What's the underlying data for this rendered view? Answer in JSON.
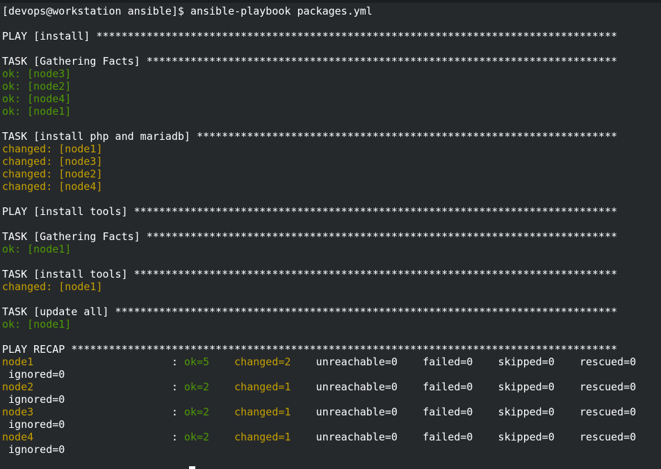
{
  "terminal": {
    "colors": {
      "background": "#26292c",
      "default_text": "#ffffff",
      "ok": "#4e9a06",
      "changed": "#c4a000"
    },
    "lines": [
      [
        {
          "t": "[devops@workstation ansible]$ ansible-playbook packages.yml",
          "c": "default_text"
        }
      ],
      [],
      [
        {
          "t": "PLAY [install] ***********************************************************************************",
          "c": "default_text"
        }
      ],
      [],
      [
        {
          "t": "TASK [Gathering Facts] ***************************************************************************",
          "c": "default_text"
        }
      ],
      [
        {
          "t": "ok: [node3]",
          "c": "ok"
        }
      ],
      [
        {
          "t": "ok: [node2]",
          "c": "ok"
        }
      ],
      [
        {
          "t": "ok: [node4]",
          "c": "ok"
        }
      ],
      [
        {
          "t": "ok: [node1]",
          "c": "ok"
        }
      ],
      [],
      [
        {
          "t": "TASK [install php and mariadb] *******************************************************************",
          "c": "default_text"
        }
      ],
      [
        {
          "t": "changed: [node1]",
          "c": "changed"
        }
      ],
      [
        {
          "t": "changed: [node3]",
          "c": "changed"
        }
      ],
      [
        {
          "t": "changed: [node2]",
          "c": "changed"
        }
      ],
      [
        {
          "t": "changed: [node4]",
          "c": "changed"
        }
      ],
      [],
      [
        {
          "t": "PLAY [install tools] *****************************************************************************",
          "c": "default_text"
        }
      ],
      [],
      [
        {
          "t": "TASK [Gathering Facts] ***************************************************************************",
          "c": "default_text"
        }
      ],
      [
        {
          "t": "ok: [node1]",
          "c": "ok"
        }
      ],
      [],
      [
        {
          "t": "TASK [install tools] *****************************************************************************",
          "c": "default_text"
        }
      ],
      [
        {
          "t": "changed: [node1]",
          "c": "changed"
        }
      ],
      [],
      [
        {
          "t": "TASK [update all] ********************************************************************************",
          "c": "default_text"
        }
      ],
      [
        {
          "t": "ok: [node1]",
          "c": "ok"
        }
      ],
      [],
      [
        {
          "t": "PLAY RECAP ***************************************************************************************",
          "c": "default_text"
        }
      ],
      [
        {
          "t": "node1",
          "c": "changed"
        },
        {
          "t": "                      : ",
          "c": "default_text"
        },
        {
          "t": "ok=5",
          "c": "ok"
        },
        {
          "t": "    ",
          "c": "default_text"
        },
        {
          "t": "changed=2",
          "c": "changed"
        },
        {
          "t": "    unreachable=0    failed=0    skipped=0    rescued=0",
          "c": "default_text"
        }
      ],
      [
        {
          "t": " ignored=0",
          "c": "default_text"
        }
      ],
      [
        {
          "t": "node2",
          "c": "changed"
        },
        {
          "t": "                      : ",
          "c": "default_text"
        },
        {
          "t": "ok=2",
          "c": "ok"
        },
        {
          "t": "    ",
          "c": "default_text"
        },
        {
          "t": "changed=1",
          "c": "changed"
        },
        {
          "t": "    unreachable=0    failed=0    skipped=0    rescued=0",
          "c": "default_text"
        }
      ],
      [
        {
          "t": " ignored=0",
          "c": "default_text"
        }
      ],
      [
        {
          "t": "node3",
          "c": "changed"
        },
        {
          "t": "                      : ",
          "c": "default_text"
        },
        {
          "t": "ok=2",
          "c": "ok"
        },
        {
          "t": "    ",
          "c": "default_text"
        },
        {
          "t": "changed=1",
          "c": "changed"
        },
        {
          "t": "    unreachable=0    failed=0    skipped=0    rescued=0",
          "c": "default_text"
        }
      ],
      [
        {
          "t": " ignored=0",
          "c": "default_text"
        }
      ],
      [
        {
          "t": "node4",
          "c": "changed"
        },
        {
          "t": "                      : ",
          "c": "default_text"
        },
        {
          "t": "ok=2",
          "c": "ok"
        },
        {
          "t": "    ",
          "c": "default_text"
        },
        {
          "t": "changed=1",
          "c": "changed"
        },
        {
          "t": "    unreachable=0    failed=0    skipped=0    rescued=0",
          "c": "default_text"
        }
      ],
      [
        {
          "t": " ignored=0",
          "c": "default_text"
        }
      ]
    ]
  }
}
